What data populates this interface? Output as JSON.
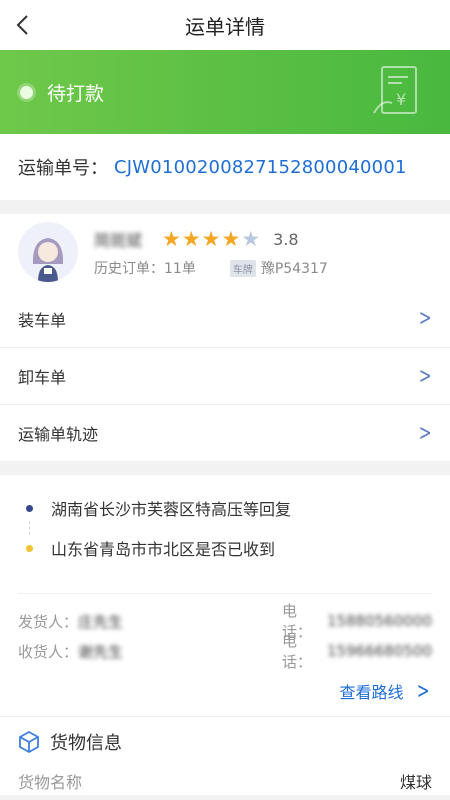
{
  "nav": {
    "title": "运单详情"
  },
  "status": {
    "label": "待打款",
    "accent": "#4fbb41"
  },
  "waybill": {
    "label": "运输单号：",
    "number": "CJW0100200827152800040001"
  },
  "driver": {
    "name": "简斑斌",
    "rating_stars": 3.8,
    "rating": "3.8",
    "history_orders": "历史订单：11单",
    "plate_tag": "车牌",
    "plate": "豫P54317"
  },
  "menu": [
    {
      "label": "装车单"
    },
    {
      "label": "卸车单"
    },
    {
      "label": "运输单轨迹"
    }
  ],
  "route": {
    "origin": "湖南省长沙市芙蓉区特高压等回复",
    "destination": "山东省青岛市市北区是否已收到"
  },
  "contacts": {
    "shipper_label": "发货人：",
    "shipper_name": "庄先生",
    "shipper_phone_label": "电话：",
    "shipper_phone": "15880560000",
    "receiver_label": "收货人：",
    "receiver_name": "谢先生",
    "receiver_phone_label": "电话：",
    "receiver_phone": "15966680500"
  },
  "view_route": "查看路线",
  "goods": {
    "title": "货物信息",
    "name_label": "货物名称",
    "name_value": "煤球"
  }
}
